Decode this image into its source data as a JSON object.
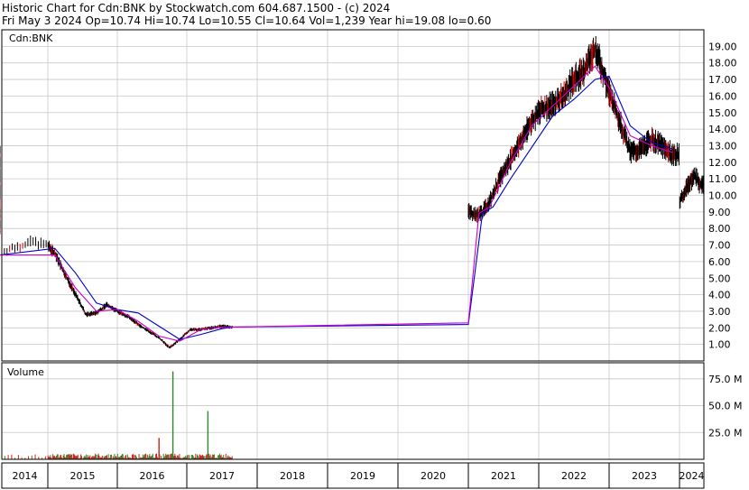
{
  "header": {
    "line1": "Historic Chart for Cdn:BNK by Stockwatch.com 604.687.1500 - (c) 2024",
    "line2": "Fri May  3 2024  Op=10.74  Hi=10.74  Lo=10.55  Cl=10.64  Vol=1,239  Year hi=19.08  lo=0.60"
  },
  "colors": {
    "price_bar": "#000000",
    "up_tick": "#d00000",
    "ma_short": "#cc00cc",
    "ma_long": "#0000cc",
    "volume_low": "#2a8a2a",
    "volume_high": "#d02020",
    "grid": "#c8c8c8"
  },
  "chart_data": [
    {
      "type": "line",
      "title": "Cdn:BNK",
      "ylim": [
        0,
        20
      ],
      "y_ticks": [
        "1.00",
        "2.00",
        "3.00",
        "4.00",
        "5.00",
        "6.00",
        "7.00",
        "8.00",
        "9.00",
        "10.00",
        "11.00",
        "12.00",
        "13.00",
        "14.00",
        "15.00",
        "16.00",
        "17.00",
        "18.00",
        "19.00"
      ],
      "x_labels": [
        "2014",
        "2015",
        "2016",
        "2017",
        "2018",
        "2019",
        "2020",
        "2021",
        "2022",
        "2023",
        "2024"
      ],
      "series": [
        {
          "key": "price",
          "x": [
            2013.8,
            2013.95,
            2014.1,
            2014.25,
            2014.4,
            2014.55,
            2014.7,
            2014.85,
            2015.0,
            2015.15,
            2015.3,
            2015.45,
            2015.6,
            2015.75,
            2015.9,
            2016.05,
            2016.2,
            2016.35,
            2016.5,
            2016.65,
            2020.0,
            2020.1,
            2020.2,
            2020.3,
            2020.45,
            2020.6,
            2020.75,
            2020.9,
            2021.05,
            2021.2,
            2021.35,
            2021.5,
            2021.65,
            2021.8,
            2021.9,
            2022.0,
            2022.15,
            2022.3,
            2022.45,
            2022.6,
            2022.75,
            2022.9,
            2023.05,
            2023.2,
            2023.35,
            2023.5,
            2023.65,
            2023.8,
            2023.95,
            2024.1,
            2024.25,
            2024.34
          ],
          "y": [
            6.3,
            7.2,
            6.5,
            5.2,
            4.0,
            2.8,
            2.9,
            3.4,
            3.0,
            2.7,
            2.2,
            1.8,
            1.4,
            0.8,
            1.3,
            1.9,
            1.9,
            2.0,
            2.1,
            2.05,
            9.1,
            8.8,
            9.0,
            9.6,
            11.0,
            12.2,
            13.3,
            14.5,
            15.2,
            15.5,
            16.0,
            17.0,
            17.5,
            18.9,
            17.6,
            16.2,
            14.5,
            12.6,
            12.8,
            13.4,
            13.0,
            12.5,
            12.4,
            10.8,
            11.0,
            10.6,
            9.8,
            8.0,
            9.2,
            10.4,
            11.2,
            10.64
          ]
        },
        {
          "key": "ma_short",
          "x": [
            2013.8,
            2014.1,
            2014.4,
            2014.7,
            2015.0,
            2015.3,
            2015.6,
            2015.9,
            2016.2,
            2016.5,
            2016.65,
            2020.0,
            2020.15,
            2020.3,
            2020.6,
            2020.9,
            2021.2,
            2021.5,
            2021.8,
            2022.0,
            2022.3,
            2022.6,
            2022.9,
            2023.2,
            2023.5,
            2023.8,
            2024.1,
            2024.34
          ],
          "y": [
            6.4,
            6.4,
            4.4,
            3.0,
            3.1,
            2.4,
            1.5,
            1.2,
            1.9,
            2.05,
            2.05,
            2.3,
            8.9,
            9.3,
            12.0,
            14.2,
            15.4,
            16.6,
            17.8,
            16.5,
            13.6,
            13.0,
            12.6,
            11.2,
            10.4,
            9.2,
            10.3,
            10.7
          ]
        },
        {
          "key": "ma_long",
          "x": [
            2013.8,
            2014.1,
            2014.4,
            2014.7,
            2015.0,
            2015.3,
            2015.6,
            2015.9,
            2016.2,
            2016.5,
            2016.65,
            2020.0,
            2020.2,
            2020.35,
            2020.6,
            2020.9,
            2021.2,
            2021.5,
            2021.8,
            2022.0,
            2022.3,
            2022.6,
            2022.9,
            2023.2,
            2023.5,
            2023.8,
            2024.1,
            2024.34
          ],
          "y": [
            6.3,
            6.8,
            5.3,
            3.5,
            3.1,
            2.9,
            2.1,
            1.3,
            1.6,
            1.95,
            2.05,
            2.2,
            8.9,
            9.3,
            11.0,
            12.9,
            14.8,
            15.8,
            17.0,
            17.2,
            14.2,
            13.2,
            12.8,
            11.8,
            10.9,
            10.0,
            10.3,
            10.6
          ]
        }
      ]
    },
    {
      "type": "bar",
      "title": "Volume",
      "ylim": [
        0,
        90
      ],
      "y_ticks": [
        "25.0 M",
        "50.0 M",
        "75.0 M"
      ],
      "spikes": [
        {
          "x": 2015.6,
          "y": 20
        },
        {
          "x": 2015.8,
          "y": 82
        },
        {
          "x": 2016.3,
          "y": 45
        }
      ]
    }
  ]
}
